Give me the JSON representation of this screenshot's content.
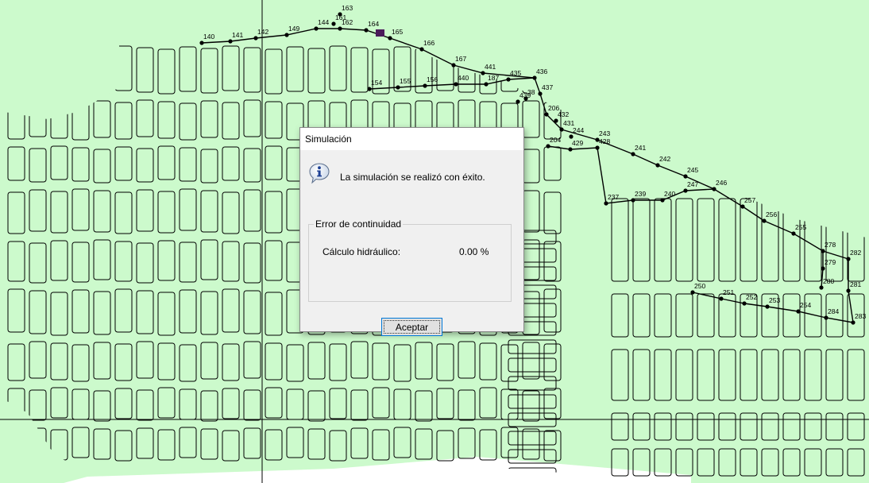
{
  "map": {
    "background_color": "#ccfacc",
    "line_color": "#000000",
    "junction_color": "#000000",
    "selected_node_color": "#4a1a5a",
    "node_labels": [
      "163",
      "161",
      "144",
      "162",
      "164",
      "165",
      "140",
      "141",
      "142",
      "149",
      "166",
      "167",
      "441",
      "436",
      "435",
      "187",
      "440",
      "156",
      "155",
      "154",
      "437",
      "439",
      "38",
      "206",
      "432",
      "431",
      "243",
      "244",
      "429",
      "428",
      "204",
      "241",
      "242",
      "245",
      "246",
      "247",
      "240",
      "239",
      "237",
      "257",
      "256",
      "255",
      "278",
      "282",
      "279",
      "280",
      "281",
      "250",
      "251",
      "252",
      "253",
      "254",
      "284",
      "283"
    ]
  },
  "dialog": {
    "title": "Simulación",
    "icon": "info-icon",
    "message": "La simulación se realizó con éxito.",
    "group_label": "Error de continuidad",
    "hydraulic_label": "Cálculo hidráulico:",
    "hydraulic_value": "0.00 %",
    "accept_label": "Aceptar",
    "accent_color": "#0078d7"
  }
}
